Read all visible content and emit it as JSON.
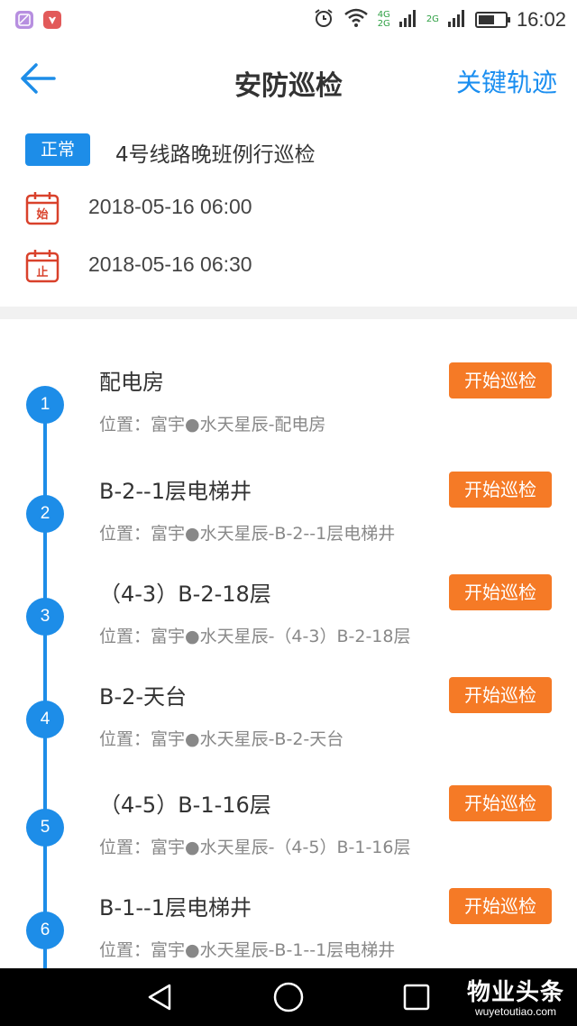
{
  "status_bar": {
    "network_top": "4G",
    "network_bottom": "2G",
    "network_alt": "2G",
    "battery_level": 0.6,
    "time": "16:02"
  },
  "header": {
    "title": "安防巡检",
    "track_link": "关键轨迹"
  },
  "task": {
    "status_badge": "正常",
    "title": "4号线路晚班例行巡检",
    "start_icon_char": "始",
    "start_time": "2018-05-16 06:00",
    "end_icon_char": "止",
    "end_time": "2018-05-16 06:30"
  },
  "checkpoints": [
    {
      "index": "1",
      "name": "配电房",
      "location": "位置：富宇●水天星辰-配电房",
      "action": "开始巡检"
    },
    {
      "index": "2",
      "name": "B-2--1层电梯井",
      "location": "位置：富宇●水天星辰-B-2--1层电梯井",
      "action": "开始巡检"
    },
    {
      "index": "3",
      "name": "（4-3）B-2-18层",
      "location": "位置：富宇●水天星辰-（4-3）B-2-18层",
      "action": "开始巡检"
    },
    {
      "index": "4",
      "name": "B-2-天台",
      "location": "位置：富宇●水天星辰-B-2-天台",
      "action": "开始巡检"
    },
    {
      "index": "5",
      "name": "（4-5）B-1-16层",
      "location": "位置：富宇●水天星辰-（4-5）B-1-16层",
      "action": "开始巡检"
    },
    {
      "index": "6",
      "name": "B-1--1层电梯井",
      "location": "位置：富宇●水天星辰-B-1--1层电梯井",
      "action": "开始巡检"
    }
  ],
  "watermark": {
    "main": "物业头条",
    "sub": "wuyetoutiao.com"
  },
  "colors": {
    "accent_blue": "#1d8de8",
    "action_orange": "#f57a26",
    "link_blue": "#1a8ef0",
    "calendar_red": "#d9412b"
  }
}
